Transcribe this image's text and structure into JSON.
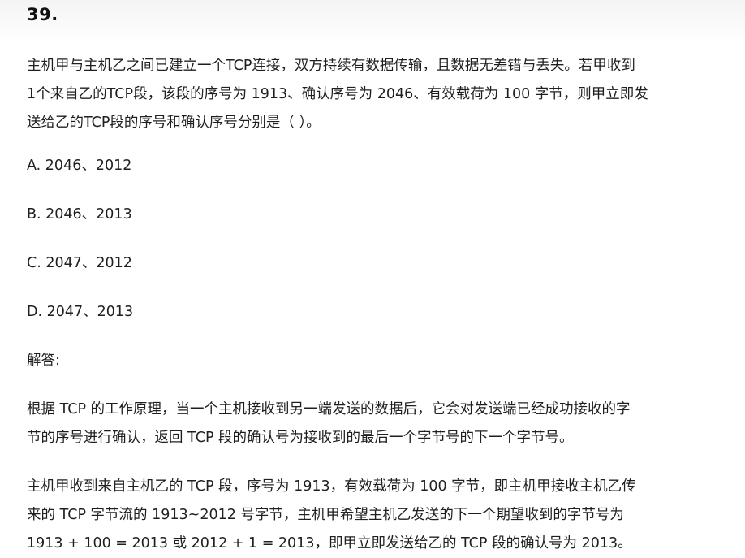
{
  "question": {
    "number": "39.",
    "text_lines": [
      "主机甲与主机乙之间已建立一个TCP连接，双方持续有数据传输，且数据无差错与丢失。若甲收到",
      "1个来自乙的TCP段，该段的序号为 1913、确认序号为 2046、有效载荷为 100 字节，则甲立即发",
      "送给乙的TCP段的序号和确认序号分别是（ ）。"
    ]
  },
  "options": [
    "A. 2046、2012",
    "B. 2046、2013",
    "C. 2047、2012",
    "D. 2047、2013"
  ],
  "answer": {
    "label": "解答:",
    "paragraph1_lines": [
      "根据 TCP 的工作原理，当一个主机接收到另一端发送的数据后，它会对发送端已经成功接收的字",
      "节的序号进行确认，返回 TCP 段的确认号为接收到的最后一个字节号的下一个字节号。"
    ],
    "paragraph2_lines": [
      "主机甲收到来自主机乙的 TCP 段，序号为 1913，有效载荷为 100 字节，即主机甲接收主机乙传",
      "来的 TCP 字节流的 1913~2012 号字节，主机甲希望主机乙发送的下一个期望收到的字节号为",
      "1913 + 100 = 2013 或 2012 + 1 = 2013，即甲立即发送给乙的 TCP 段的确认号为 2013。"
    ]
  }
}
